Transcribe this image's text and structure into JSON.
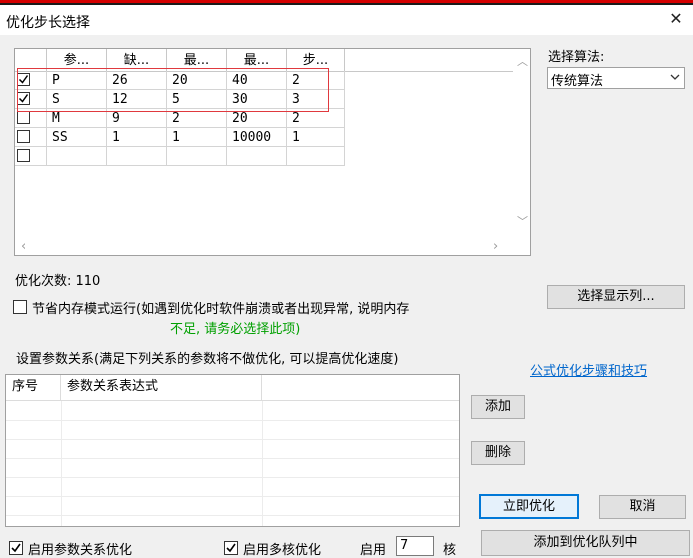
{
  "window": {
    "title": "优化步长选择",
    "close_symbol": "✕"
  },
  "params_table": {
    "headers": [
      "参...",
      "缺...",
      "最...",
      "最...",
      "步..."
    ],
    "rows": [
      {
        "checked": true,
        "name": "P",
        "default": "26",
        "min": "20",
        "max": "40",
        "step": "2"
      },
      {
        "checked": true,
        "name": "S",
        "default": "12",
        "min": "5",
        "max": "30",
        "step": "3"
      },
      {
        "checked": false,
        "name": "M",
        "default": "9",
        "min": "2",
        "max": "20",
        "step": "2"
      },
      {
        "checked": false,
        "name": "SS",
        "default": "1",
        "min": "1",
        "max": "10000",
        "step": "1"
      },
      {
        "checked": false,
        "name": "",
        "default": "",
        "min": "",
        "max": "",
        "step": ""
      }
    ]
  },
  "algorithm": {
    "label": "选择算法:",
    "selected": "传统算法"
  },
  "optimization_count": {
    "text": "优化次数: 110"
  },
  "select_columns_button": "选择显示列...",
  "memory_mode": {
    "checked": false,
    "line1": "节省内存模式运行(如遇到优化时软件崩溃或者出现异常, 说明内存",
    "line2": "不足, 请务必选择此项)"
  },
  "relations": {
    "caption": "设置参数关系(满足下列关系的参数将不做优化, 可以提高优化速度)",
    "tips_link": "公式优化步骤和技巧",
    "headers": [
      "序号",
      "参数关系表达式"
    ],
    "add_button": "添加",
    "delete_button": "删除"
  },
  "bottom": {
    "enable_relation_label": "启用参数关系优化",
    "enable_relation_checked": true,
    "enable_multicore_label": "启用多核优化",
    "enable_multicore_checked": true,
    "enable_label": "启用",
    "cores_value": "7",
    "cores_unit": "核",
    "optimize_now": "立即优化",
    "cancel": "取消",
    "add_to_queue": "添加到优化队列中"
  },
  "colors": {
    "highlight_box": "#e0393e",
    "link": "#0066cc",
    "warning_text": "#00a000",
    "default_button_border": "#0078d7"
  }
}
